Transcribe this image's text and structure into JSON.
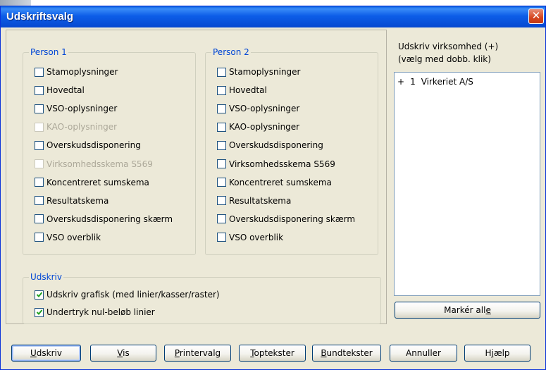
{
  "window": {
    "title": "Udskriftsvalg",
    "close_glyph": "✕"
  },
  "person1": {
    "label": "Person 1",
    "items": [
      {
        "label": "Stamoplysninger",
        "checked": false,
        "disabled": false
      },
      {
        "label": "Hovedtal",
        "checked": false,
        "disabled": false
      },
      {
        "label": "VSO-oplysninger",
        "checked": false,
        "disabled": false
      },
      {
        "label": "KAO-oplysninger",
        "checked": false,
        "disabled": true
      },
      {
        "label": "Overskudsdisponering",
        "checked": false,
        "disabled": false
      },
      {
        "label": "Virksomhedsskema S569",
        "checked": false,
        "disabled": true
      },
      {
        "label": "Koncentreret sumskema",
        "checked": false,
        "disabled": false
      },
      {
        "label": "Resultatskema",
        "checked": false,
        "disabled": false
      },
      {
        "label": "Overskudsdisponering skærm",
        "checked": false,
        "disabled": false
      },
      {
        "label": "VSO overblik",
        "checked": false,
        "disabled": false
      }
    ]
  },
  "person2": {
    "label": "Person 2",
    "items": [
      {
        "label": "Stamoplysninger",
        "checked": false,
        "disabled": false
      },
      {
        "label": "Hovedtal",
        "checked": false,
        "disabled": false
      },
      {
        "label": "VSO-oplysninger",
        "checked": false,
        "disabled": false
      },
      {
        "label": "KAO-oplysninger",
        "checked": false,
        "disabled": false
      },
      {
        "label": "Overskudsdisponering",
        "checked": false,
        "disabled": false
      },
      {
        "label": "Virksomhedsskema S569",
        "checked": false,
        "disabled": false
      },
      {
        "label": "Koncentreret sumskema",
        "checked": false,
        "disabled": false
      },
      {
        "label": "Resultatskema",
        "checked": false,
        "disabled": false
      },
      {
        "label": "Overskudsdisponering skærm",
        "checked": false,
        "disabled": false
      },
      {
        "label": "VSO overblik",
        "checked": false,
        "disabled": false
      }
    ]
  },
  "udskriv_group": {
    "label": "Udskriv",
    "items": [
      {
        "label": "Udskriv grafisk (med linier/kasser/raster)",
        "checked": true,
        "disabled": false
      },
      {
        "label": "Undertryk nul-beløb linier",
        "checked": true,
        "disabled": false
      }
    ]
  },
  "virksomhed": {
    "label_line1": "Udskriv virksomhed (+)",
    "label_line2": "(vælg med dobb. klik)",
    "items": [
      {
        "marker": "+",
        "number": "1",
        "name": "Virkeriet A/S"
      }
    ],
    "select_all": {
      "label": "Markér alle",
      "accel": "e"
    }
  },
  "buttons": [
    {
      "label": "Udskriv",
      "accel": "U"
    },
    {
      "label": "Vis",
      "accel": "V"
    },
    {
      "label": "Printervalg",
      "accel": "P"
    },
    {
      "label": "Toptekster",
      "accel": "T"
    },
    {
      "label": "Bundtekster",
      "accel": "B"
    },
    {
      "label": "Annuller",
      "accel": ""
    },
    {
      "label": "Hjælp",
      "accel": "j"
    }
  ],
  "colors": {
    "title_bar": "#0a5fe0",
    "group_label": "#0046d5",
    "dialog_bg": "#ece9d8",
    "check": "#21a121"
  }
}
